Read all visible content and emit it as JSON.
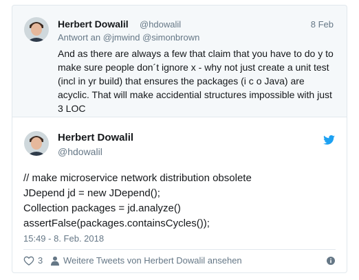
{
  "parent_tweet": {
    "author_name": "Herbert Dowalil",
    "handle": "@hdowalil",
    "date": "8 Feb",
    "reply_prefix": "Antwort an",
    "reply_mentions": [
      "@jmwind",
      "@simonbrown"
    ],
    "text_lines": [
      "And as there are always a few that claim that you have to do y to",
      "make sure people don´t ignore x - why not just create a unit test",
      "(incl in yr build) that ensures the packages (i c o Java) are",
      "acyclic. That will make accidential structures impossible with just",
      "3 LOC"
    ]
  },
  "main_tweet": {
    "author_name": "Herbert Dowalil",
    "handle": "@hdowalil",
    "code_lines": [
      "// make microservice network distribution obsolete",
      "JDepend jd = new JDepend();",
      "Collection packages = jd.analyze()",
      "assertFalse(packages.containsCycles());"
    ],
    "timestamp": "15:49 - 8. Feb. 2018",
    "like_count": "3",
    "more_tweets_link": "Weitere Tweets von Herbert Dowalil ansehen"
  },
  "icons": {
    "brand": "twitter-bird-icon",
    "like": "heart-icon",
    "profile": "person-icon",
    "info": "info-icon"
  },
  "colors": {
    "twitter_blue": "#1da1f2",
    "secondary_text": "#657786",
    "primary_text": "#14171a",
    "parent_background": "#f5f8fa",
    "border": "#e1e8ed"
  }
}
